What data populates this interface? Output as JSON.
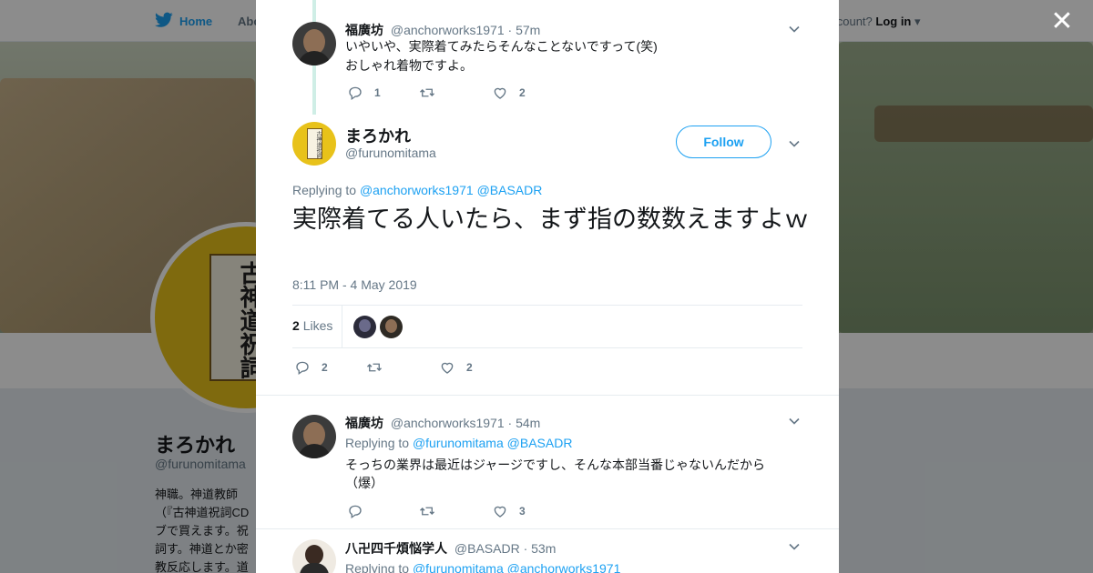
{
  "topbar": {
    "home_label": "Home",
    "about_label": "Abo",
    "account_text": "account?",
    "login_label": "Log in"
  },
  "profile": {
    "name": "まろかれ",
    "handle": "@furunomitama",
    "bio": "神職。神道教師（『古神道祝詞CDブで買えます。祝詞す。神道とか密教反応します。道名",
    "avatar_text": "古神道祝詞"
  },
  "modal": {
    "close_label": "✕",
    "tweets": [
      {
        "name": "福廣坊",
        "handle": "@anchorworks1971",
        "time": "· 57m",
        "text_lines": [
          "いやいや、実際着てみたらそんなことないですって(笑)",
          "おしゃれ着物ですよ。"
        ],
        "replies": "1",
        "retweets": "",
        "likes": "2"
      }
    ],
    "main": {
      "name": "まろかれ",
      "handle": "@furunomitama",
      "follow_label": "Follow",
      "replying_prefix": "Replying to",
      "replying_to": [
        "@anchorworks1971",
        "@BASADR"
      ],
      "text": "実際着てる人いたら、まず指の数数えますよｗ",
      "timestamp": "8:11 PM - 4 May 2019",
      "likes_count": "2",
      "likes_label": "Likes",
      "replies": "2",
      "retweets": "",
      "likes": "2"
    },
    "replies": [
      {
        "name": "福廣坊",
        "handle": "@anchorworks1971",
        "time": "· 54m",
        "replying_prefix": "Replying to",
        "replying_to": [
          "@furunomitama",
          "@BASADR"
        ],
        "text_lines": [
          "そっちの業界は最近はジャージですし、そんな本部当番じゃないんだから",
          "（爆）"
        ],
        "replies": "",
        "retweets": "",
        "likes": "3"
      },
      {
        "name": "八卍四千煩悩学人",
        "handle": "@BASADR",
        "time": "· 53m",
        "replying_prefix": "Replying to",
        "replying_to": [
          "@furunomitama",
          "@anchorworks1971"
        ]
      }
    ]
  },
  "colors": {
    "brand": "#1da1f2",
    "muted": "#657786",
    "thread": "#cfeee6"
  },
  "icons": [
    "twitter-bird-icon",
    "close-icon",
    "chevron-down-icon",
    "reply-icon",
    "retweet-icon",
    "heart-icon"
  ]
}
